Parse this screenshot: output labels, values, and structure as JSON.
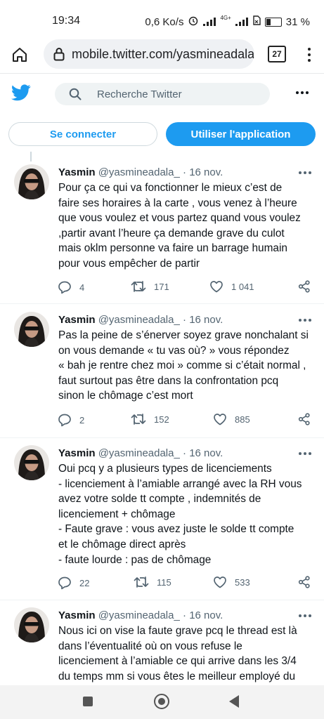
{
  "status": {
    "time": "19:34",
    "speed": "0,6 Ko/s",
    "network": "4G+",
    "battery": "31 %"
  },
  "browser": {
    "url": "mobile.twitter.com/yasmineadala",
    "tab_count": "27"
  },
  "header": {
    "search_placeholder": "Recherche Twitter",
    "login_label": "Se connecter",
    "app_label": "Utiliser l'application"
  },
  "tweets": [
    {
      "name": "Yasmin",
      "handle": "@yasmineadala_",
      "date": "16 nov.",
      "text": "Pour ça ce qui va fonctionner le mieux c’est de\nfaire ses horaires à la carte , vous venez à l’heure\nque vous voulez et vous partez quand vous voulez\n,partir avant l’heure ça demande grave du culot\nmais oklm personne va faire un barrage humain\npour vous empêcher de partir",
      "replies": "4",
      "retweets": "171",
      "likes": "1 041"
    },
    {
      "name": "Yasmin",
      "handle": "@yasmineadala_",
      "date": "16 nov.",
      "text": "Pas la peine de s’énerver soyez grave nonchalant si\non vous demande « tu vas où? » vous répondez\n« bah je rentre chez moi » comme si c’était normal ,\nfaut surtout pas être dans la confrontation pcq\nsinon le chômage c’est mort",
      "replies": "2",
      "retweets": "152",
      "likes": "885"
    },
    {
      "name": "Yasmin",
      "handle": "@yasmineadala_",
      "date": "16 nov.",
      "text": "Oui pcq y a plusieurs types de licenciements\n- licenciement à l’amiable arrangé avec la RH vous\navez votre solde tt compte , indemnités de\nlicenciement + chômage\n- Faute grave : vous avez juste le solde tt compte\net le chômage direct après\n- faute lourde : pas de chômage",
      "replies": "22",
      "retweets": "115",
      "likes": "533"
    },
    {
      "name": "Yasmin",
      "handle": "@yasmineadala_",
      "date": "16 nov.",
      "text": "Nous ici on vise la faute grave pcq le thread est là\ndans l’éventualité où on vous refuse le\nlicenciement à l’amiable ce qui arrive dans les 3/4\ndu temps mm si vous êtes le meilleur employé du",
      "replies": "",
      "retweets": "",
      "likes": ""
    }
  ],
  "colors": {
    "accent": "#1d9bf0",
    "text": "#0f1419",
    "secondary": "#536471"
  }
}
